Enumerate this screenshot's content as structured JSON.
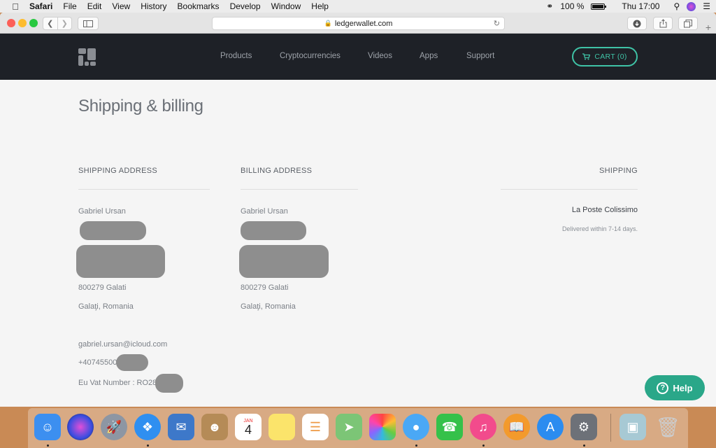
{
  "menubar": {
    "app_name": "Safari",
    "items": [
      "File",
      "Edit",
      "View",
      "History",
      "Bookmarks",
      "Develop",
      "Window",
      "Help"
    ],
    "battery_text": "100 %",
    "battery_level": 1.0,
    "clock": "Thu 17:00"
  },
  "browser": {
    "url": "ledgerwallet.com",
    "new_tab_symbol": "+"
  },
  "site": {
    "nav": [
      "Products",
      "Cryptocurrencies",
      "Videos",
      "Apps",
      "Support"
    ],
    "cart_label": "CART (0)",
    "accent": "#3fc3a6"
  },
  "page": {
    "title": "Shipping & billing",
    "shipping_address": {
      "heading": "SHIPPING ADDRESS",
      "name": "Gabriel Ursan",
      "postal_city": "800279 Galati",
      "region_country": "Galaţi, Romania",
      "email": "gabriel.ursan@icloud.com",
      "phone": "+40745500",
      "vat": "Eu Vat Number : RO28"
    },
    "billing_address": {
      "heading": "BILLING ADDRESS",
      "name": "Gabriel Ursan",
      "postal_city": "800279 Galati",
      "region_country": "Galaţi, Romania"
    },
    "shipping": {
      "heading": "SHIPPING",
      "method": "La Poste Colissimo",
      "note": "Delivered within 7-14 days."
    },
    "help_label": "Help"
  },
  "dock": {
    "calendar_month": "JAN",
    "calendar_day": "4",
    "apps": [
      {
        "name": "Finder",
        "color": "#3c8ff0"
      },
      {
        "name": "Siri",
        "color": "#3a2c6e"
      },
      {
        "name": "Launchpad",
        "color": "#8d96a3"
      },
      {
        "name": "Safari",
        "color": "#2f8ff0"
      },
      {
        "name": "Mail",
        "color": "#3d78c9"
      },
      {
        "name": "Contacts",
        "color": "#b58b57"
      },
      {
        "name": "Calendar",
        "color": "#ffffff"
      },
      {
        "name": "Notes",
        "color": "#fbe46b"
      },
      {
        "name": "Reminders",
        "color": "#ffffff"
      },
      {
        "name": "Maps",
        "color": "#7cc576"
      },
      {
        "name": "Photos",
        "color": "#ffffff"
      },
      {
        "name": "Messages",
        "color": "#4aa8f5"
      },
      {
        "name": "FaceTime",
        "color": "#35c14a"
      },
      {
        "name": "iTunes",
        "color": "#f24b8c"
      },
      {
        "name": "iBooks",
        "color": "#f39a2c"
      },
      {
        "name": "App Store",
        "color": "#2b8cf0"
      },
      {
        "name": "System Preferences",
        "color": "#6d7178"
      },
      {
        "name": "Preview",
        "color": "#a7c9d4"
      },
      {
        "name": "Trash",
        "color": "#d8dde2"
      }
    ]
  }
}
